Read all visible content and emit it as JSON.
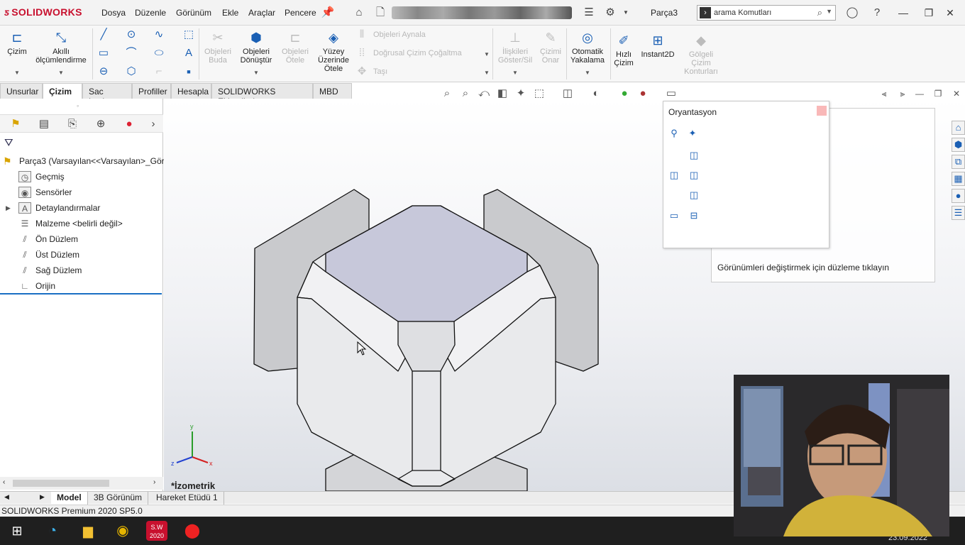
{
  "titlebar": {
    "logo": "SOLIDWORKS",
    "menu": [
      "Dosya",
      "Düzenle",
      "Görünüm",
      "Ekle",
      "Araçlar",
      "Pencere"
    ],
    "doc_name": "Parça3",
    "search_placeholder": "arama Komutları"
  },
  "ribbon": {
    "cizim": "Çizim",
    "akilli": "Akıllı ölçümlendirme",
    "objeleri_buda": "Objeleri Buda",
    "objeleri_donustur": "Objeleri Dönüştür",
    "objeleri_otele": "Objeleri Ötele",
    "yuzey_uzerinde_otele": "Yüzey Üzerinde Ötele",
    "objeleri_aynala": "Objeleri Aynala",
    "dogrusal_cogaltma": "Doğrusal Çizim Çoğaltma",
    "tasi": "Taşı",
    "iliskileri_goster": "İlişkileri Göster/Sil",
    "cizimi_onar": "Çizimi Onar",
    "otomatik_yakalama": "Otomatik Yakalama",
    "hizli_cizim": "Hızlı Çizim",
    "instant2d": "Instant2D",
    "golgeli_cizim": "Gölgeli Çizim Konturları"
  },
  "tabs": [
    "Unsurlar",
    "Çizim",
    "Sac Levha",
    "Profiller",
    "Hesapla",
    "SOLIDWORKS Eklentileri",
    "MBD"
  ],
  "active_tab": "Çizim",
  "tree": {
    "root": "Parça3  (Varsayılan<<Varsayılan>_Gör",
    "items": [
      "Geçmiş",
      "Sensörler",
      "Detaylandırmalar",
      "Malzeme <belirli değil>",
      "Ön Düzlem",
      "Üst Düzlem",
      "Sağ Düzlem",
      "Orijin"
    ]
  },
  "viewport": {
    "view_label": "*İzometrik",
    "triad": {
      "x": "x",
      "y": "y",
      "z": "z"
    }
  },
  "orientation": {
    "title": "Oryantasyon",
    "tooltip": "Görünümleri değiştirmek için düzleme tıklayın"
  },
  "bottom_tabs": [
    "Model",
    "3B Görünüm",
    "Hareket Etüdü 1"
  ],
  "status": "SOLIDWORKS Premium 2020 SP5.0",
  "taskbar": {
    "date": "23.09.2022",
    "sw_badge": "2020"
  },
  "colors": {
    "brand": "#c8102e",
    "accent": "#1a5fb4",
    "taskbar": "#1f1f1f"
  }
}
